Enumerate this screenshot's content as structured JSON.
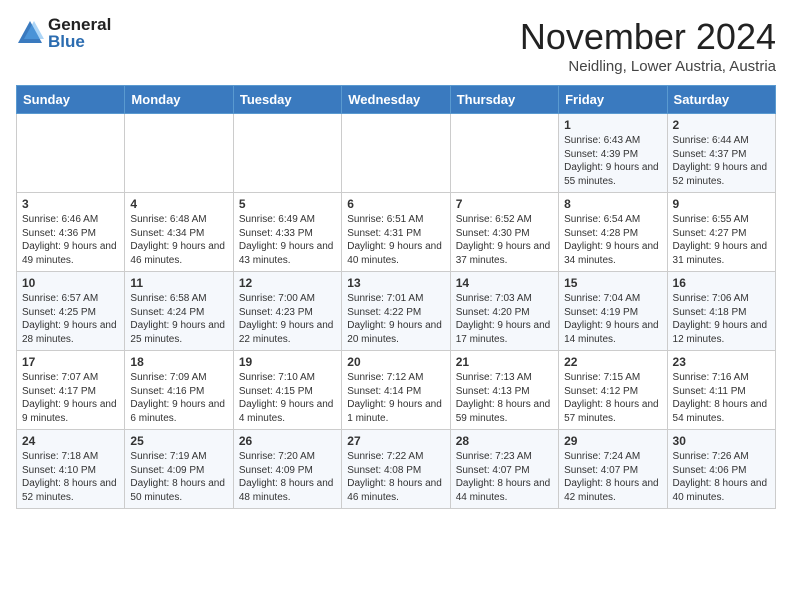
{
  "logo": {
    "general": "General",
    "blue": "Blue"
  },
  "title": "November 2024",
  "location": "Neidling, Lower Austria, Austria",
  "weekdays": [
    "Sunday",
    "Monday",
    "Tuesday",
    "Wednesday",
    "Thursday",
    "Friday",
    "Saturday"
  ],
  "weeks": [
    [
      {
        "day": "",
        "info": ""
      },
      {
        "day": "",
        "info": ""
      },
      {
        "day": "",
        "info": ""
      },
      {
        "day": "",
        "info": ""
      },
      {
        "day": "",
        "info": ""
      },
      {
        "day": "1",
        "info": "Sunrise: 6:43 AM\nSunset: 4:39 PM\nDaylight: 9 hours and 55 minutes."
      },
      {
        "day": "2",
        "info": "Sunrise: 6:44 AM\nSunset: 4:37 PM\nDaylight: 9 hours and 52 minutes."
      }
    ],
    [
      {
        "day": "3",
        "info": "Sunrise: 6:46 AM\nSunset: 4:36 PM\nDaylight: 9 hours and 49 minutes."
      },
      {
        "day": "4",
        "info": "Sunrise: 6:48 AM\nSunset: 4:34 PM\nDaylight: 9 hours and 46 minutes."
      },
      {
        "day": "5",
        "info": "Sunrise: 6:49 AM\nSunset: 4:33 PM\nDaylight: 9 hours and 43 minutes."
      },
      {
        "day": "6",
        "info": "Sunrise: 6:51 AM\nSunset: 4:31 PM\nDaylight: 9 hours and 40 minutes."
      },
      {
        "day": "7",
        "info": "Sunrise: 6:52 AM\nSunset: 4:30 PM\nDaylight: 9 hours and 37 minutes."
      },
      {
        "day": "8",
        "info": "Sunrise: 6:54 AM\nSunset: 4:28 PM\nDaylight: 9 hours and 34 minutes."
      },
      {
        "day": "9",
        "info": "Sunrise: 6:55 AM\nSunset: 4:27 PM\nDaylight: 9 hours and 31 minutes."
      }
    ],
    [
      {
        "day": "10",
        "info": "Sunrise: 6:57 AM\nSunset: 4:25 PM\nDaylight: 9 hours and 28 minutes."
      },
      {
        "day": "11",
        "info": "Sunrise: 6:58 AM\nSunset: 4:24 PM\nDaylight: 9 hours and 25 minutes."
      },
      {
        "day": "12",
        "info": "Sunrise: 7:00 AM\nSunset: 4:23 PM\nDaylight: 9 hours and 22 minutes."
      },
      {
        "day": "13",
        "info": "Sunrise: 7:01 AM\nSunset: 4:22 PM\nDaylight: 9 hours and 20 minutes."
      },
      {
        "day": "14",
        "info": "Sunrise: 7:03 AM\nSunset: 4:20 PM\nDaylight: 9 hours and 17 minutes."
      },
      {
        "day": "15",
        "info": "Sunrise: 7:04 AM\nSunset: 4:19 PM\nDaylight: 9 hours and 14 minutes."
      },
      {
        "day": "16",
        "info": "Sunrise: 7:06 AM\nSunset: 4:18 PM\nDaylight: 9 hours and 12 minutes."
      }
    ],
    [
      {
        "day": "17",
        "info": "Sunrise: 7:07 AM\nSunset: 4:17 PM\nDaylight: 9 hours and 9 minutes."
      },
      {
        "day": "18",
        "info": "Sunrise: 7:09 AM\nSunset: 4:16 PM\nDaylight: 9 hours and 6 minutes."
      },
      {
        "day": "19",
        "info": "Sunrise: 7:10 AM\nSunset: 4:15 PM\nDaylight: 9 hours and 4 minutes."
      },
      {
        "day": "20",
        "info": "Sunrise: 7:12 AM\nSunset: 4:14 PM\nDaylight: 9 hours and 1 minute."
      },
      {
        "day": "21",
        "info": "Sunrise: 7:13 AM\nSunset: 4:13 PM\nDaylight: 8 hours and 59 minutes."
      },
      {
        "day": "22",
        "info": "Sunrise: 7:15 AM\nSunset: 4:12 PM\nDaylight: 8 hours and 57 minutes."
      },
      {
        "day": "23",
        "info": "Sunrise: 7:16 AM\nSunset: 4:11 PM\nDaylight: 8 hours and 54 minutes."
      }
    ],
    [
      {
        "day": "24",
        "info": "Sunrise: 7:18 AM\nSunset: 4:10 PM\nDaylight: 8 hours and 52 minutes."
      },
      {
        "day": "25",
        "info": "Sunrise: 7:19 AM\nSunset: 4:09 PM\nDaylight: 8 hours and 50 minutes."
      },
      {
        "day": "26",
        "info": "Sunrise: 7:20 AM\nSunset: 4:09 PM\nDaylight: 8 hours and 48 minutes."
      },
      {
        "day": "27",
        "info": "Sunrise: 7:22 AM\nSunset: 4:08 PM\nDaylight: 8 hours and 46 minutes."
      },
      {
        "day": "28",
        "info": "Sunrise: 7:23 AM\nSunset: 4:07 PM\nDaylight: 8 hours and 44 minutes."
      },
      {
        "day": "29",
        "info": "Sunrise: 7:24 AM\nSunset: 4:07 PM\nDaylight: 8 hours and 42 minutes."
      },
      {
        "day": "30",
        "info": "Sunrise: 7:26 AM\nSunset: 4:06 PM\nDaylight: 8 hours and 40 minutes."
      }
    ]
  ]
}
